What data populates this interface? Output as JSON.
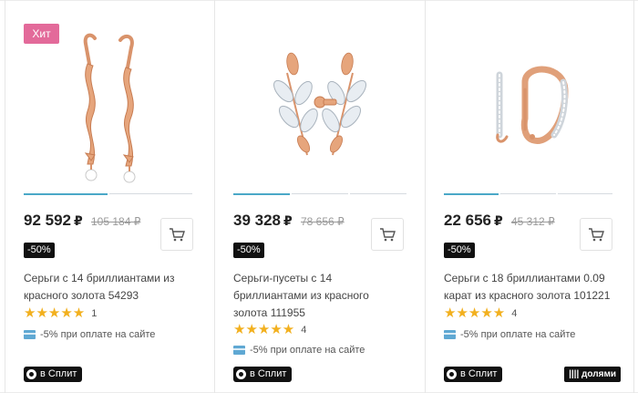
{
  "products": [
    {
      "badge": "Хит",
      "price": "92 592",
      "currency": "₽",
      "old_price": "105 184 ₽",
      "discount": "-50%",
      "title": "Серьги с 14 бриллиантами из красного золота 54293",
      "rating": 5,
      "stars": "★★★★★",
      "reviews": "1",
      "pay_note": "-5% при оплате на сайте",
      "split_label": "в Сплит",
      "slides": 2,
      "active_slide": 1
    },
    {
      "badge": "",
      "price": "39 328",
      "currency": "₽",
      "old_price": "78 656 ₽",
      "discount": "-50%",
      "title": "Серьги-пусеты с 14 бриллиантами из красного золота 111955",
      "rating": 5,
      "stars": "★★★★★",
      "reviews": "4",
      "pay_note": "-5% при оплате на сайте",
      "split_label": "в Сплит",
      "slides": 3,
      "active_slide": 1
    },
    {
      "badge": "",
      "price": "22 656",
      "currency": "₽",
      "old_price": "45 312 ₽",
      "discount": "-50%",
      "title": "Серьги с 18 бриллиантами 0.09 карат из красного золота 101221",
      "rating": 5,
      "stars": "★★★★★",
      "reviews": "4",
      "pay_note": "-5% при оплате на сайте",
      "split_label": "в Сплит",
      "dolyami_label": "|||| долями",
      "slides": 3,
      "active_slide": 1
    }
  ],
  "colors": {
    "badge_hit": "#e36a9a",
    "star": "#f2b01e",
    "slider_active": "#4aa8c7",
    "gold": "#e0a07a"
  },
  "icons": [
    "cart-icon",
    "payment-card-icon",
    "split-logo-icon"
  ]
}
